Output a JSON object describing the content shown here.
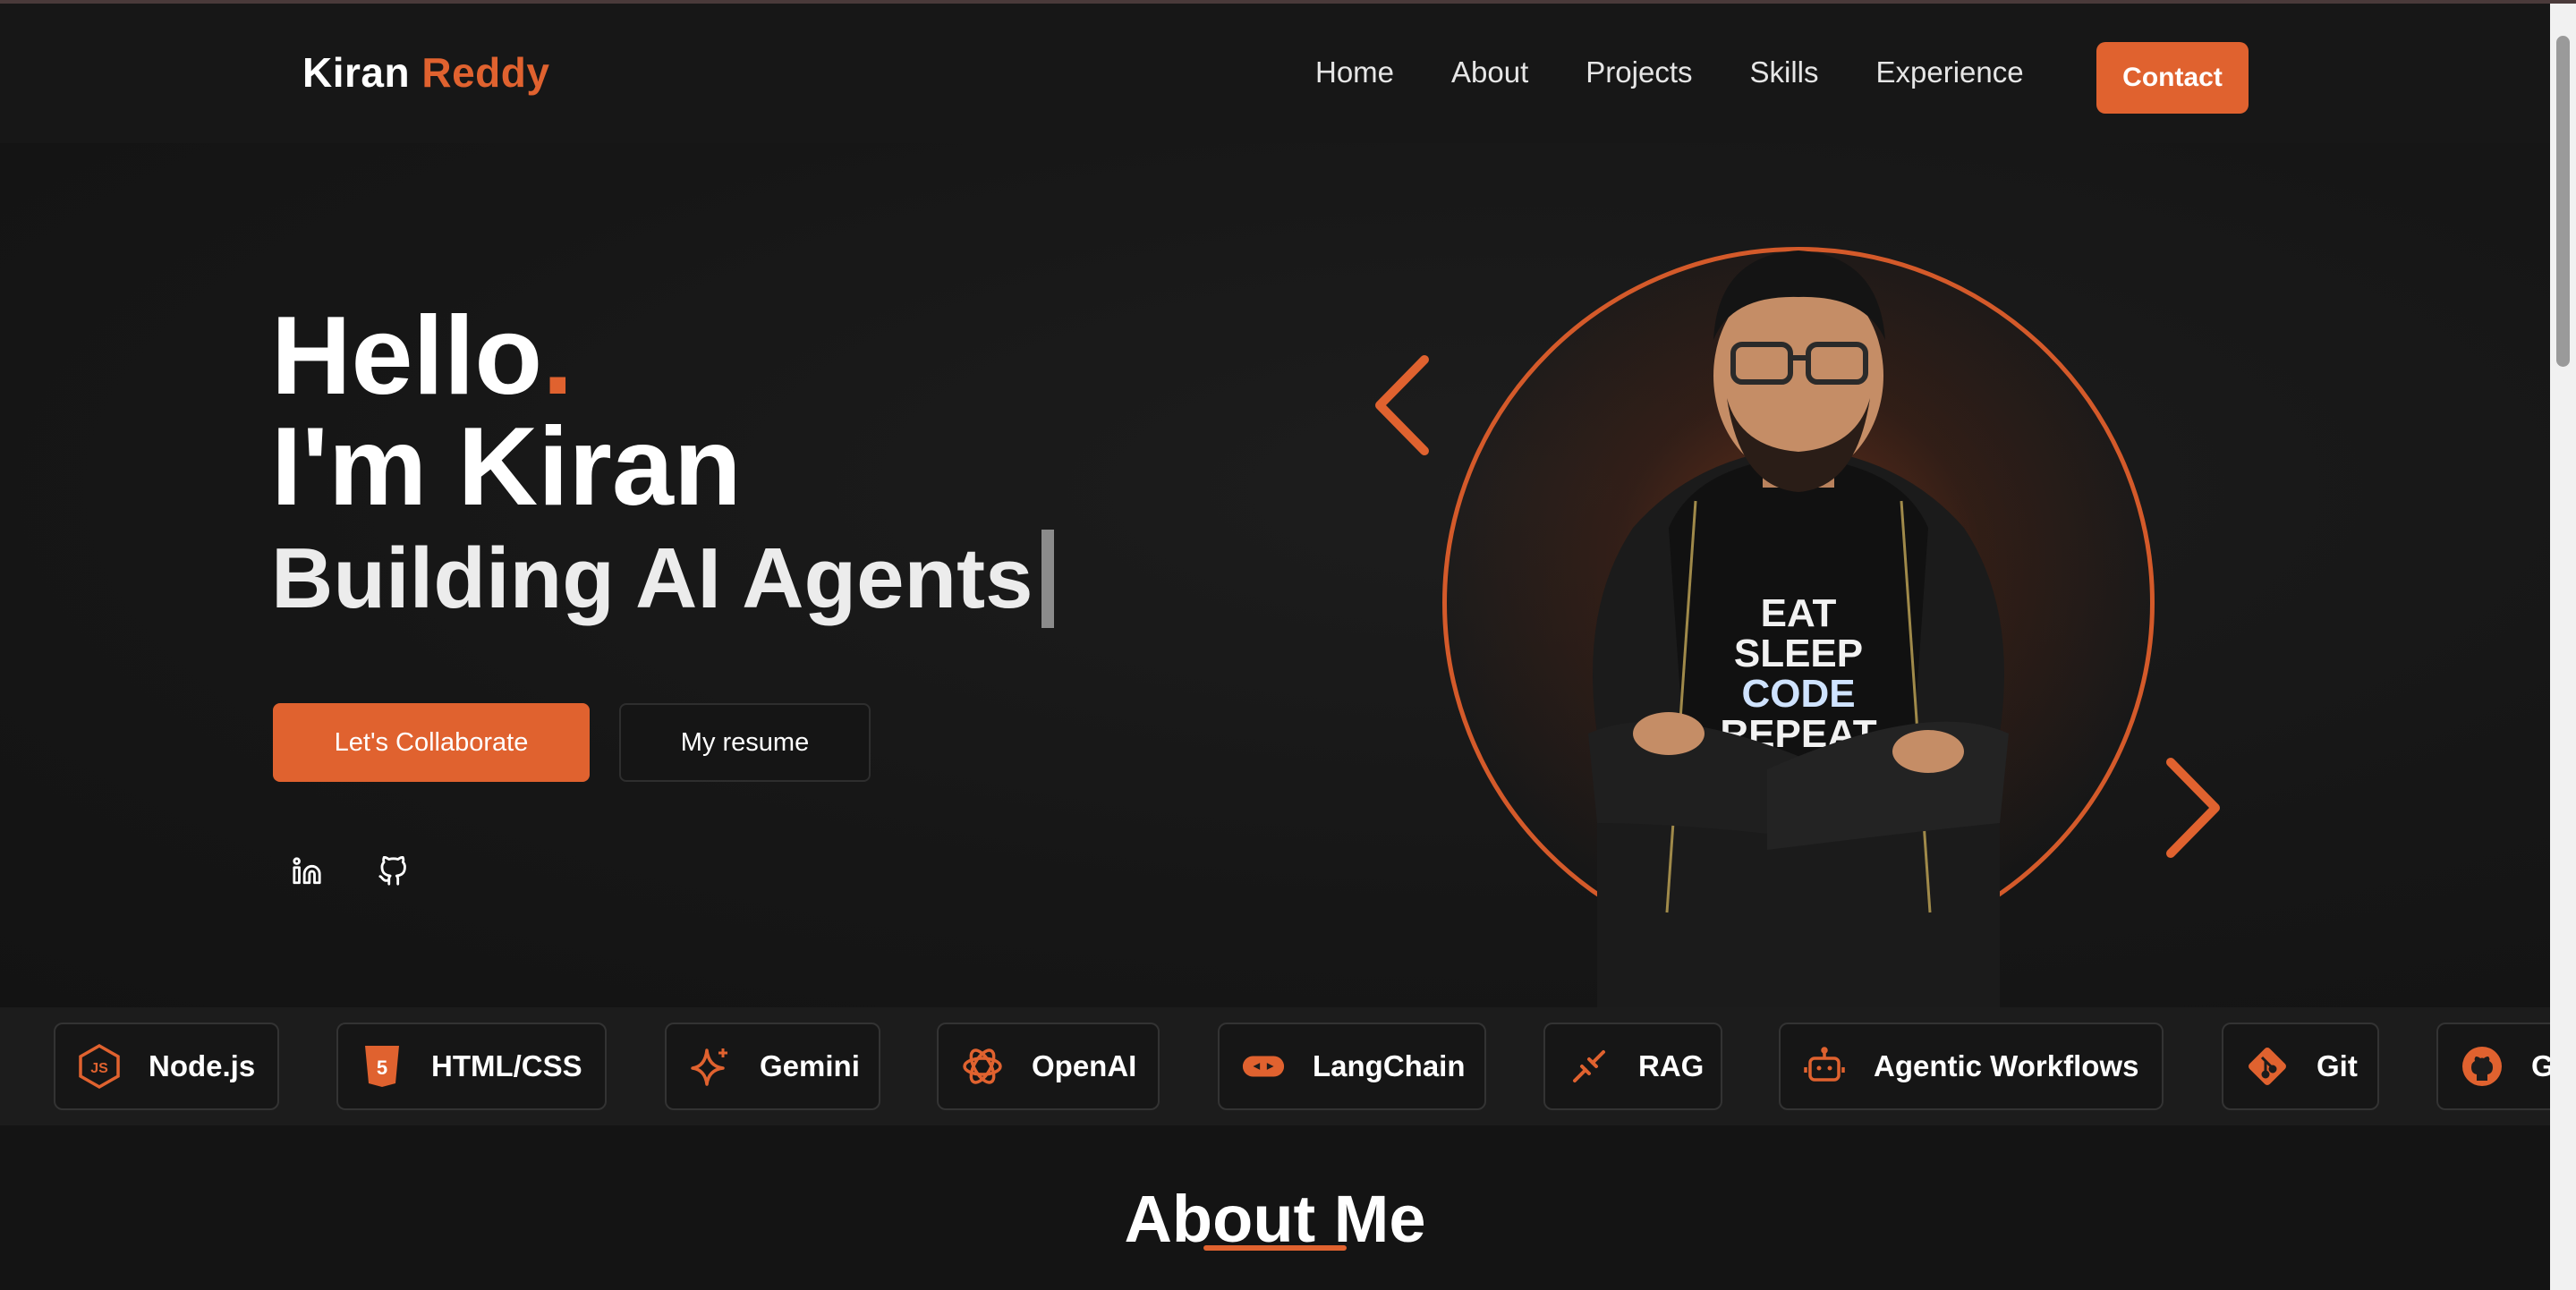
{
  "brand": {
    "first": "Kiran",
    "last": "Reddy"
  },
  "nav": {
    "links": [
      "Home",
      "About",
      "Projects",
      "Skills",
      "Experience"
    ],
    "contact_label": "Contact"
  },
  "hero": {
    "hello": "Hello",
    "hello_dot": ".",
    "intro": "I'm Kiran",
    "tagline": "Building AI Agents",
    "primary_cta": "Let's Collaborate",
    "secondary_cta": "My resume"
  },
  "social": [
    "linkedin-icon",
    "github-icon"
  ],
  "portrait": {
    "shirt_lines": [
      "EAT",
      "SLEEP",
      "CODE",
      "REPEAT"
    ]
  },
  "skills": [
    {
      "label": "Node.js",
      "icon": "nodejs-icon"
    },
    {
      "label": "HTML/CSS",
      "icon": "html5-icon"
    },
    {
      "label": "Gemini",
      "icon": "gemini-sparkle-icon"
    },
    {
      "label": "OpenAI",
      "icon": "openai-icon"
    },
    {
      "label": "LangChain",
      "icon": "langchain-icon"
    },
    {
      "label": "RAG",
      "icon": "rag-link-icon"
    },
    {
      "label": "Agentic Workflows",
      "icon": "robot-icon"
    },
    {
      "label": "Git",
      "icon": "git-icon"
    },
    {
      "label": "G",
      "icon": "github-icon"
    }
  ],
  "about": {
    "title": "About Me"
  },
  "colors": {
    "accent": "#e0622f",
    "background": "#141414",
    "strip": "#1c1c1c"
  }
}
